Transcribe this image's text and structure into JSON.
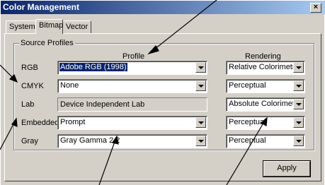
{
  "window": {
    "title": "Color Management",
    "close_glyph": "×"
  },
  "tabs": [
    {
      "label": "System",
      "active": false
    },
    {
      "label": "Bitmap",
      "active": true
    },
    {
      "label": "Vector",
      "active": false
    }
  ],
  "group": {
    "legend": "Source Profiles",
    "profile_header": "Profile",
    "rendering_header": "Rendering"
  },
  "rows": [
    {
      "label": "RGB",
      "profile": "Adobe RGB (1998)",
      "profile_selected": true,
      "rendering": "Relative Colorimetric"
    },
    {
      "label": "CMYK",
      "profile": "None",
      "rendering": "Perceptual"
    },
    {
      "label": "Lab",
      "profile": "Device Independent Lab",
      "profile_static": true,
      "rendering": "Absolute Colorimetric"
    },
    {
      "label": "Embedded",
      "profile": "Prompt",
      "rendering": "Perceptual"
    },
    {
      "label": "Gray",
      "profile": "Gray Gamma 2.2",
      "rendering": "Perceptual"
    }
  ],
  "buttons": {
    "apply": "Apply"
  },
  "colors": {
    "selection": "#0a246a",
    "dialog_face": "#d4d0c8"
  }
}
